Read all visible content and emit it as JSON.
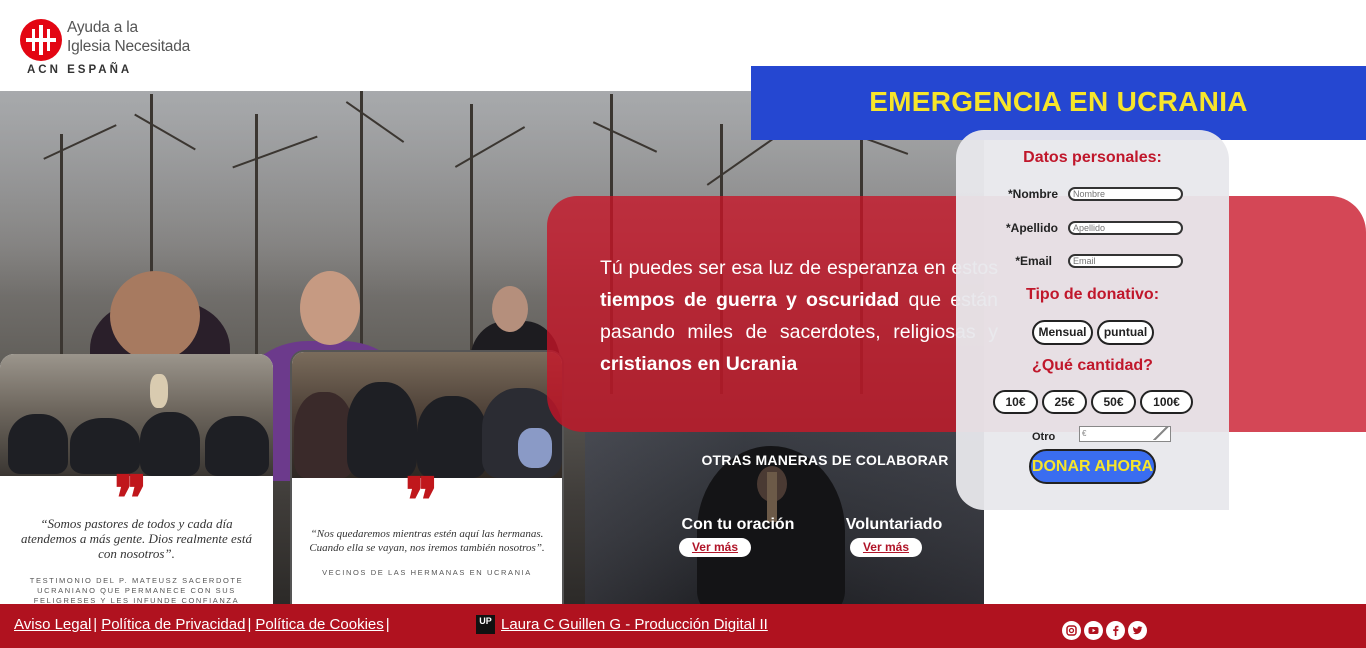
{
  "header": {
    "logo_name_line1": "Ayuda a la",
    "logo_name_line2": "Iglesia Necesitada",
    "logo_sub": "ACN ESPAÑA"
  },
  "banner": {
    "title": "EMERGENCIA EN UCRANIA"
  },
  "message": {
    "part1": "Tú puedes ser esa luz de esperanza en estos ",
    "bold1": "tiempos de guerra y oscuridad",
    "part2": " que están pasando miles de sacerdotes, religiosas y ",
    "bold2": "cristianos en Ucrania"
  },
  "form": {
    "heading_personal": "Datos personales:",
    "fields": [
      {
        "label": "*Nombre",
        "placeholder": "Nombre"
      },
      {
        "label": "*Apellido",
        "placeholder": "Apellido"
      },
      {
        "label": "*Email",
        "placeholder": "Email"
      }
    ],
    "heading_type": "Tipo de donativo:",
    "types": [
      "Mensual",
      "puntual"
    ],
    "heading_amount": "¿Qué cantidad?",
    "amounts": [
      "10€",
      "25€",
      "50€",
      "100€"
    ],
    "other_label": "Otro",
    "other_placeholder": "€",
    "submit_label": "DONAR AHORA"
  },
  "other_ways": {
    "title": "OTRAS MANERAS DE COLABORAR",
    "items": [
      {
        "label": "Con tu oración",
        "button": "Ver más"
      },
      {
        "label": "Voluntariado",
        "button": "Ver más"
      }
    ]
  },
  "testimonials": [
    {
      "quote_mark": "❞",
      "quote": "“Somos pastores de todos y cada día atendemos a más gente. Dios realmente está con nosotros”.",
      "caption": "TESTIMONIO DEL P. MATEUSZ SACERDOTE UCRANIANO QUE PERMANECE CON SUS FELIGRESES Y LES INFUNDE CONFIANZA"
    },
    {
      "quote_mark": "❞",
      "quote": "“Nos quedaremos mientras estén aquí las hermanas. Cuando ella se vayan, nos iremos también nosotros”.",
      "caption": "VECINOS DE LAS HERMANAS EN UCRANIA"
    }
  ],
  "footer": {
    "links": [
      "Aviso Legal",
      "Política de Privacidad",
      "Política de Cookies"
    ],
    "separator": "|",
    "up_logo": "UP",
    "credit": "Laura C Guillen G - Producción Digital II",
    "social_icons": [
      "instagram-icon",
      "youtube-icon",
      "facebook-icon",
      "twitter-icon"
    ]
  },
  "colors": {
    "brand_red": "#e30613",
    "panel_red": "#c81327",
    "banner_blue": "#2547d1",
    "banner_yellow": "#f7e52a",
    "footer_red": "#b0121f",
    "donate_blue": "#3a6df0"
  }
}
